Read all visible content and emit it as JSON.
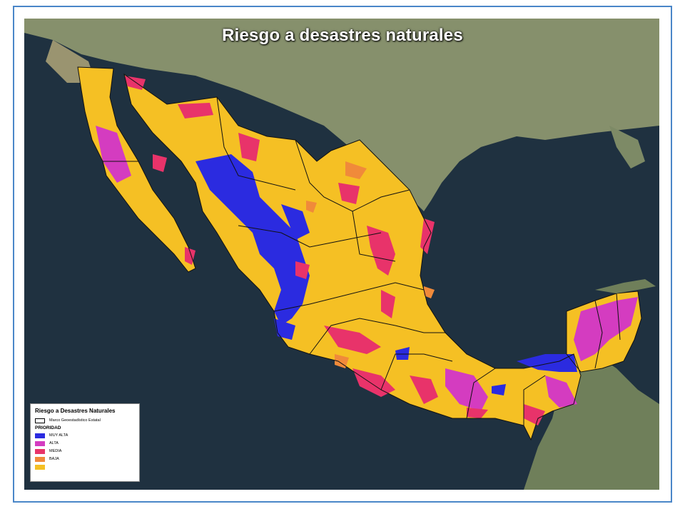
{
  "title": "Riesgo a desastres naturales",
  "legend": {
    "title": "Riesgo a Desastres Naturales",
    "boundary_label": "Marco Geoestadístico Estatal",
    "subtitle": "PRIORIDAD",
    "items": [
      {
        "label": "MUY ALTA",
        "color": "#2b2be0"
      },
      {
        "label": "ALTA",
        "color": "#d43cc0"
      },
      {
        "label": "MEDIA",
        "color": "#e8336a"
      },
      {
        "label": "BAJA",
        "color": "#f08a3a"
      },
      {
        "label": "",
        "color": "#f5c024"
      }
    ]
  },
  "colors": {
    "ocean": "#1f3140",
    "land": "#7f8a6a",
    "base_risk": "#f5c024",
    "frame": "#4a86c8"
  }
}
